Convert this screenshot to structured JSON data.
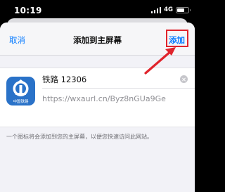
{
  "status_bar": {
    "time": "10:19",
    "network": "4G",
    "battery_level": 0.65
  },
  "nav": {
    "cancel_label": "取消",
    "title": "添加到主屏幕",
    "add_label": "添加"
  },
  "app": {
    "name": "铁路 12306",
    "url": "https://wxaurl.cn/Byz8nGUa9Ge",
    "icon_text": "中国铁路"
  },
  "hint": "一个图标将会添加到您的主屏幕，以便您快速访问此网站。",
  "annotation": {
    "color": "#e0242c"
  }
}
